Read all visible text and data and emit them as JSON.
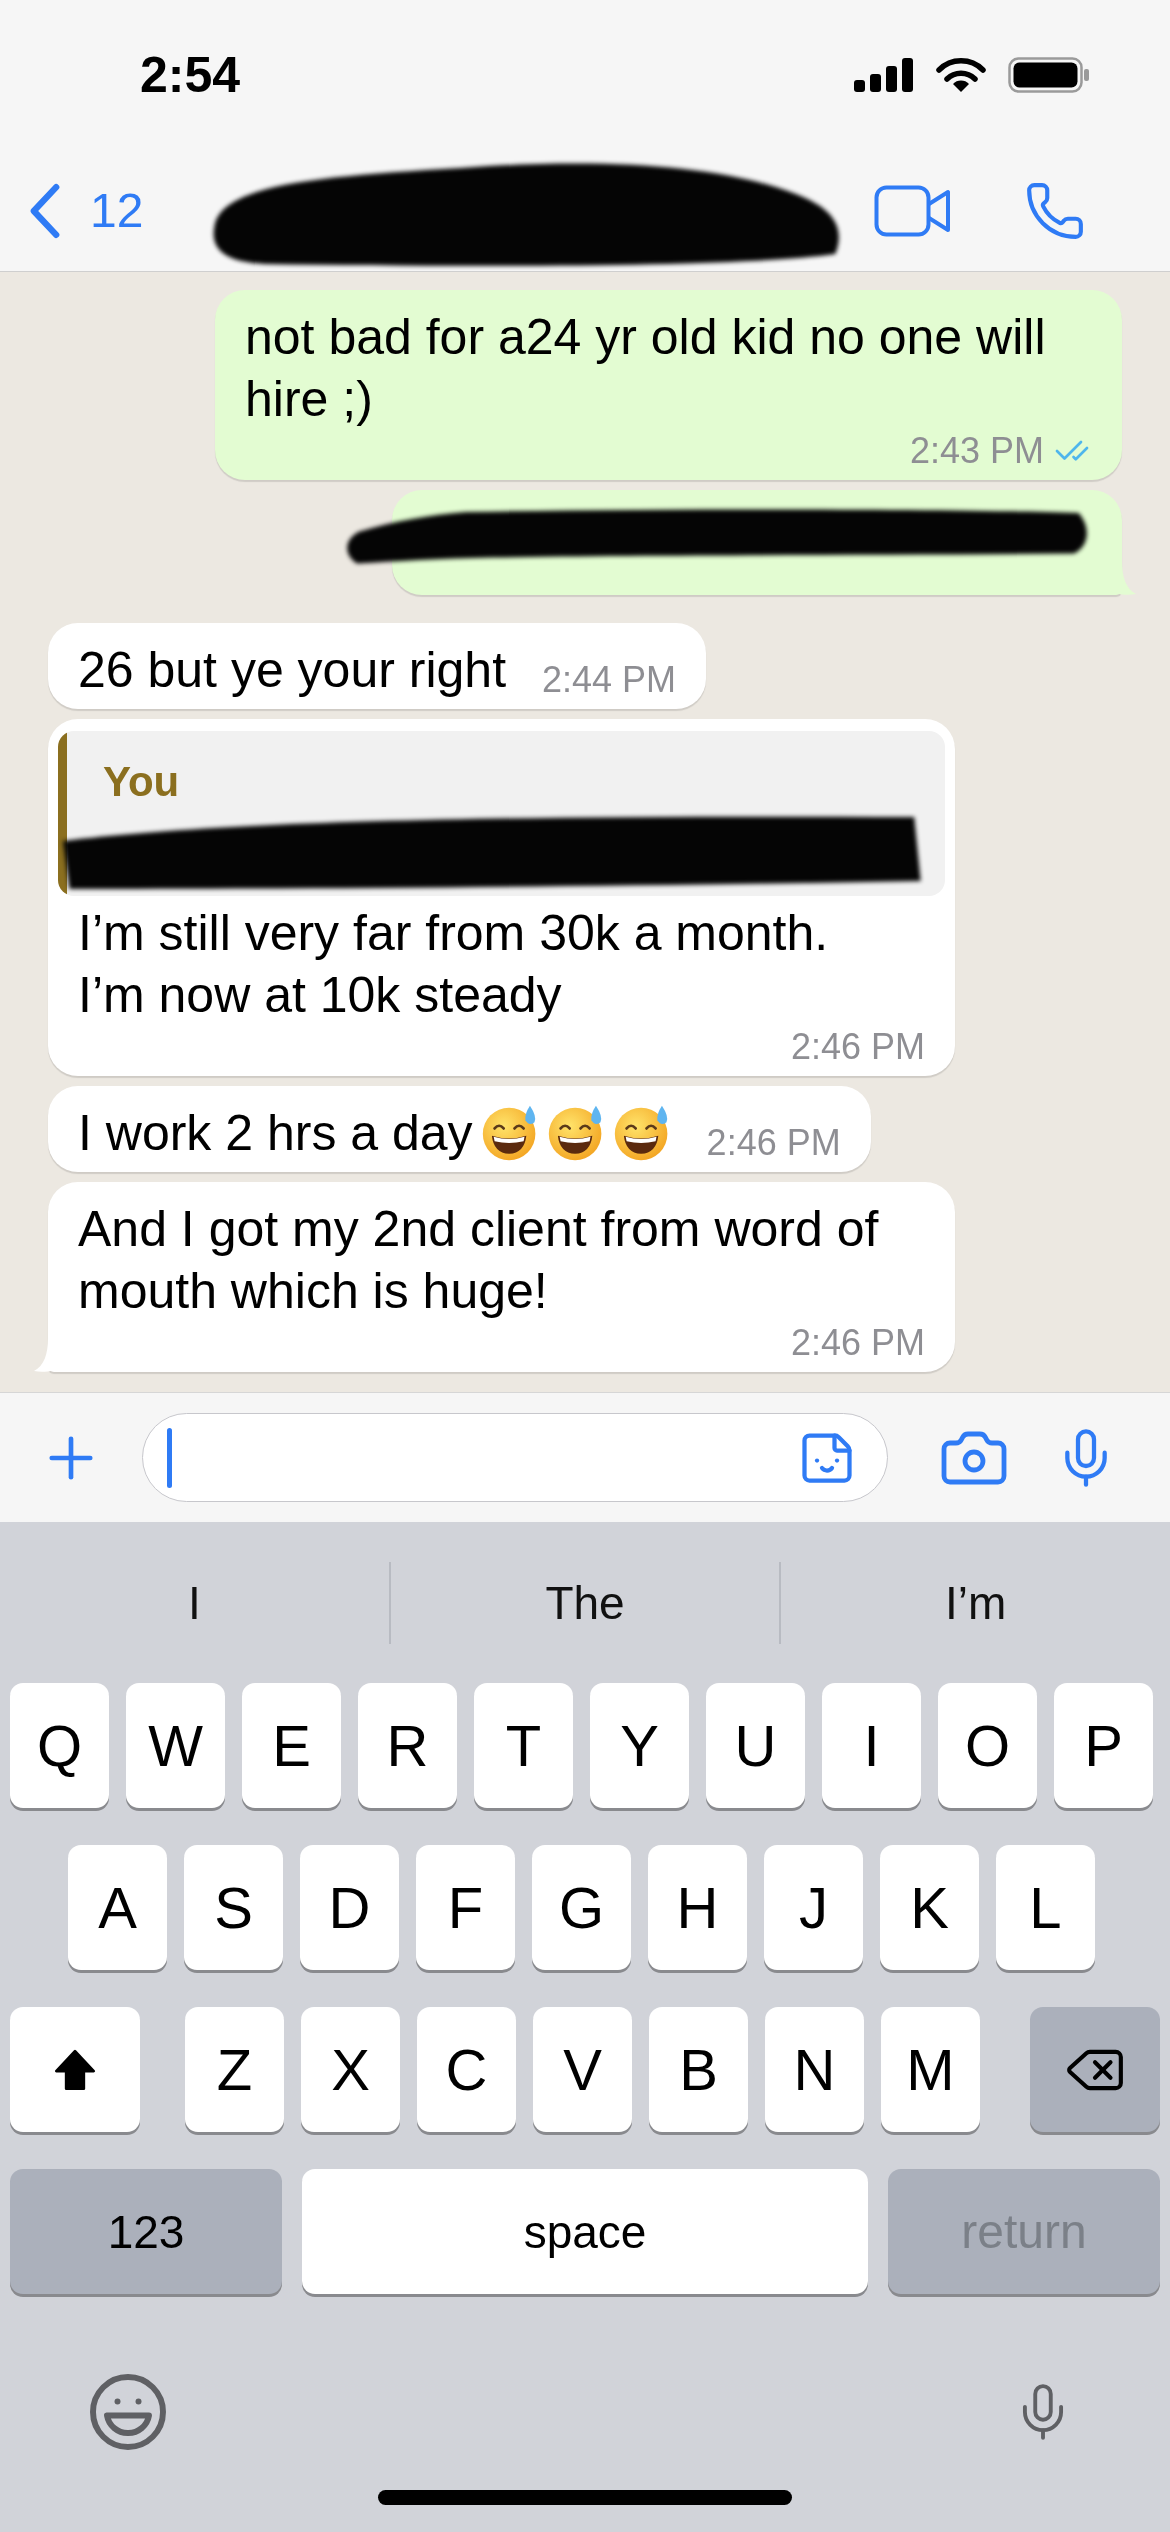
{
  "status_bar": {
    "time": "2:54"
  },
  "header": {
    "back_count": "12",
    "contact_redacted": true
  },
  "messages": [
    {
      "kind": "outgoing",
      "redacted": false,
      "tail": false,
      "text": "not bad for a24 yr old kid no one will hire ;)",
      "time": "2:43 PM",
      "read": true
    },
    {
      "kind": "outgoing",
      "redacted": true,
      "tail": true
    },
    {
      "kind": "incoming",
      "redacted": false,
      "tail": false,
      "text": "26 but ye your right",
      "time": "2:44 PM"
    },
    {
      "kind": "incoming",
      "redacted": false,
      "tail": false,
      "quote": {
        "author": "You",
        "redacted": true
      },
      "text": "I’m still very far from 30k a month. I’m now at 10k steady",
      "time": "2:46 PM"
    },
    {
      "kind": "incoming",
      "redacted": false,
      "tail": false,
      "text": "I work 2 hrs a day",
      "emoji": [
        {
          "kind": "grinning-sweat"
        },
        {
          "kind": "grinning-sweat"
        },
        {
          "kind": "grinning-sweat"
        }
      ],
      "time": "2:46 PM"
    },
    {
      "kind": "incoming",
      "redacted": false,
      "tail": true,
      "text": "And I got my 2nd client from word of mouth which is huge!",
      "time": "2:46 PM"
    }
  ],
  "composer": {
    "focused": true
  },
  "keyboard": {
    "suggestions": [
      "I",
      "The",
      "I’m"
    ],
    "rows": [
      [
        "Q",
        "W",
        "E",
        "R",
        "T",
        "Y",
        "U",
        "I",
        "O",
        "P"
      ],
      [
        "A",
        "S",
        "D",
        "F",
        "G",
        "H",
        "J",
        "K",
        "L"
      ],
      [
        "Z",
        "X",
        "C",
        "V",
        "B",
        "N",
        "M"
      ]
    ],
    "shift": {
      "on": true
    },
    "numbers_key": "123",
    "space_key": "space",
    "return_key": {
      "label": "return",
      "disabled": true
    }
  }
}
